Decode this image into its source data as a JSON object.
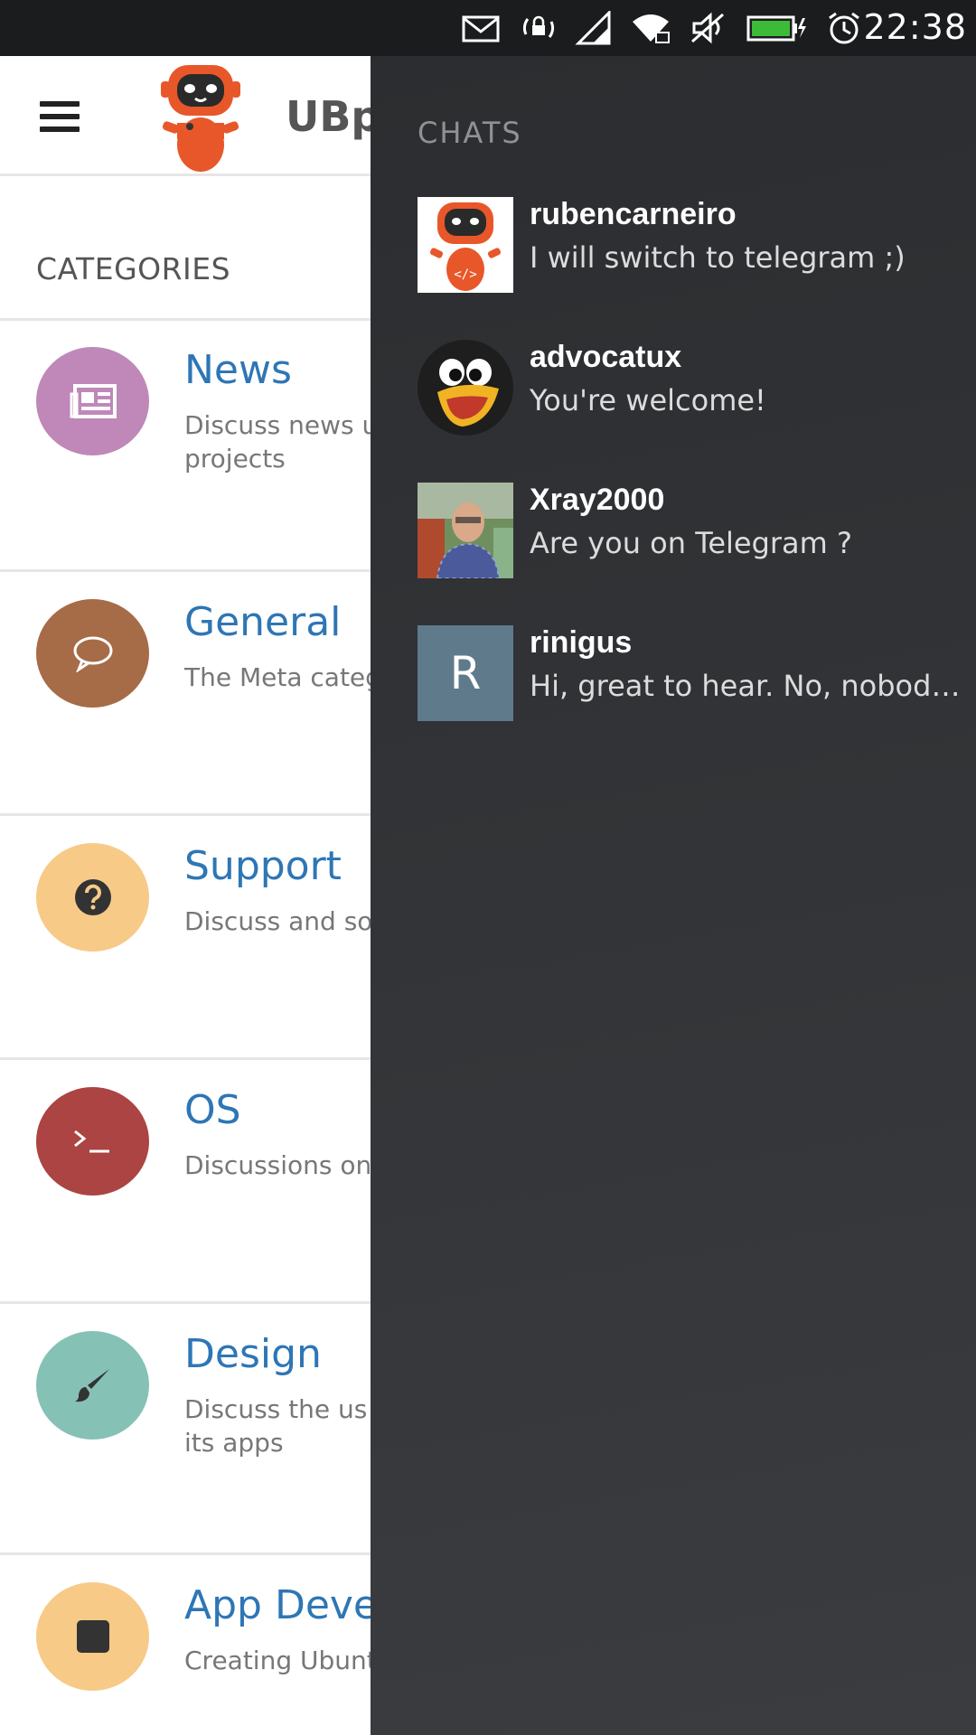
{
  "status_bar": {
    "time": "22:38",
    "icons": [
      "mail-icon",
      "rotation-lock-icon",
      "signal-icon",
      "wifi-lock-icon",
      "muted-icon",
      "battery-charging-icon",
      "alarm-icon"
    ]
  },
  "app": {
    "title": "UBp",
    "menu_icon": "hamburger-icon",
    "categories_heading": "CATEGORIES",
    "categories": [
      {
        "title": "News",
        "description": "Discuss news u \nprojects",
        "desc_line1": "Discuss news u",
        "desc_line2": "projects",
        "icon": "newspaper-icon",
        "color": "#bf88b8"
      },
      {
        "title": "General",
        "desc_line1": "The Meta categ",
        "desc_line2": "",
        "icon": "speech-bubble-icon",
        "color": "#a66b47"
      },
      {
        "title": "Support",
        "desc_line1": "Discuss and so",
        "desc_line2": "",
        "icon": "question-icon",
        "color": "#f7ca88"
      },
      {
        "title": "OS",
        "desc_line1": "Discussions on",
        "desc_line2": "",
        "icon": "terminal-icon",
        "color": "#ab4442"
      },
      {
        "title": "Design",
        "desc_line1": "Discuss the us",
        "desc_line2": "its apps",
        "icon": "paintbrush-icon",
        "color": "#86c1b6"
      },
      {
        "title": "App Devel",
        "desc_line1": "Creating Ubunt",
        "desc_line2": "",
        "icon": "square-icon",
        "color": "#f7ca88"
      }
    ]
  },
  "drawer": {
    "heading": "CHATS",
    "chats": [
      {
        "name": "rubencarneiro",
        "preview": "I will switch to telegram ;)",
        "avatar": "robot-avatar"
      },
      {
        "name": "advocatux",
        "preview": "You're welcome!",
        "avatar": "penguin-avatar"
      },
      {
        "name": "Xray2000",
        "preview": "Are you on Telegram ?",
        "avatar": "photo-avatar"
      },
      {
        "name": "rinigus",
        "preview": "Hi, great to hear. No, nobody h...",
        "avatar_letter": "R",
        "avatar": "letter-avatar"
      }
    ]
  },
  "colors": {
    "link_blue": "#2e76b5",
    "drawer_bg": "#333538",
    "status_bar_bg": "#1b1c1e",
    "robot_orange": "#e8572a"
  }
}
